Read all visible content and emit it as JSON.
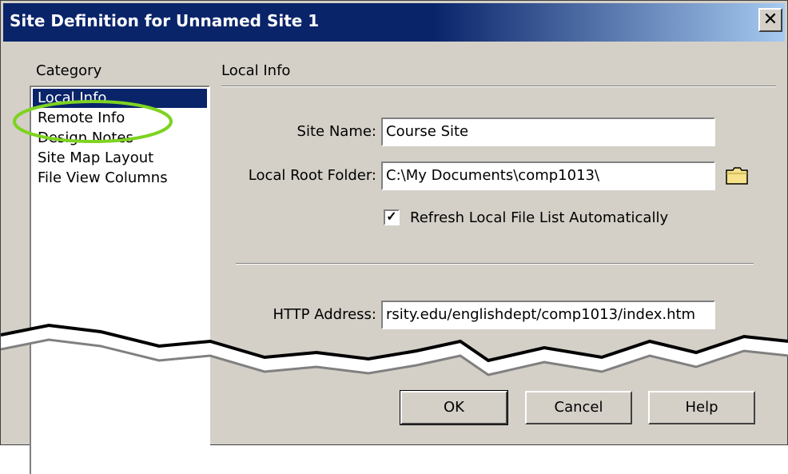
{
  "window": {
    "title": "Site Definition for Unnamed Site 1",
    "close_glyph": "✕"
  },
  "sidebar": {
    "label": "Category",
    "items": [
      {
        "label": "Local Info",
        "selected": true
      },
      {
        "label": "Remote Info"
      },
      {
        "label": "Design Notes"
      },
      {
        "label": "Site Map Layout"
      },
      {
        "label": "File View Columns"
      }
    ]
  },
  "main": {
    "section_title": "Local Info",
    "site_name": {
      "label": "Site Name:",
      "value": "Course Site"
    },
    "local_root": {
      "label": "Local Root Folder:",
      "value": "C:\\My Documents\\comp1013\\",
      "icon": "folder-icon"
    },
    "refresh": {
      "label": "Refresh Local File List Automatically",
      "checked": true,
      "glyph": "✓"
    },
    "http": {
      "label": "HTTP Address:",
      "value": "rsity.edu/englishdept/comp1013/index.htm"
    }
  },
  "buttons": {
    "ok": "OK",
    "cancel": "Cancel",
    "help": "Help"
  },
  "annotation": {
    "highlight_color": "#7ed321",
    "highlight_target": "Remote Info"
  },
  "colors": {
    "title_bar": "#0a246a",
    "dialog_face": "#d4d0c8",
    "selection": "#0a246a"
  }
}
